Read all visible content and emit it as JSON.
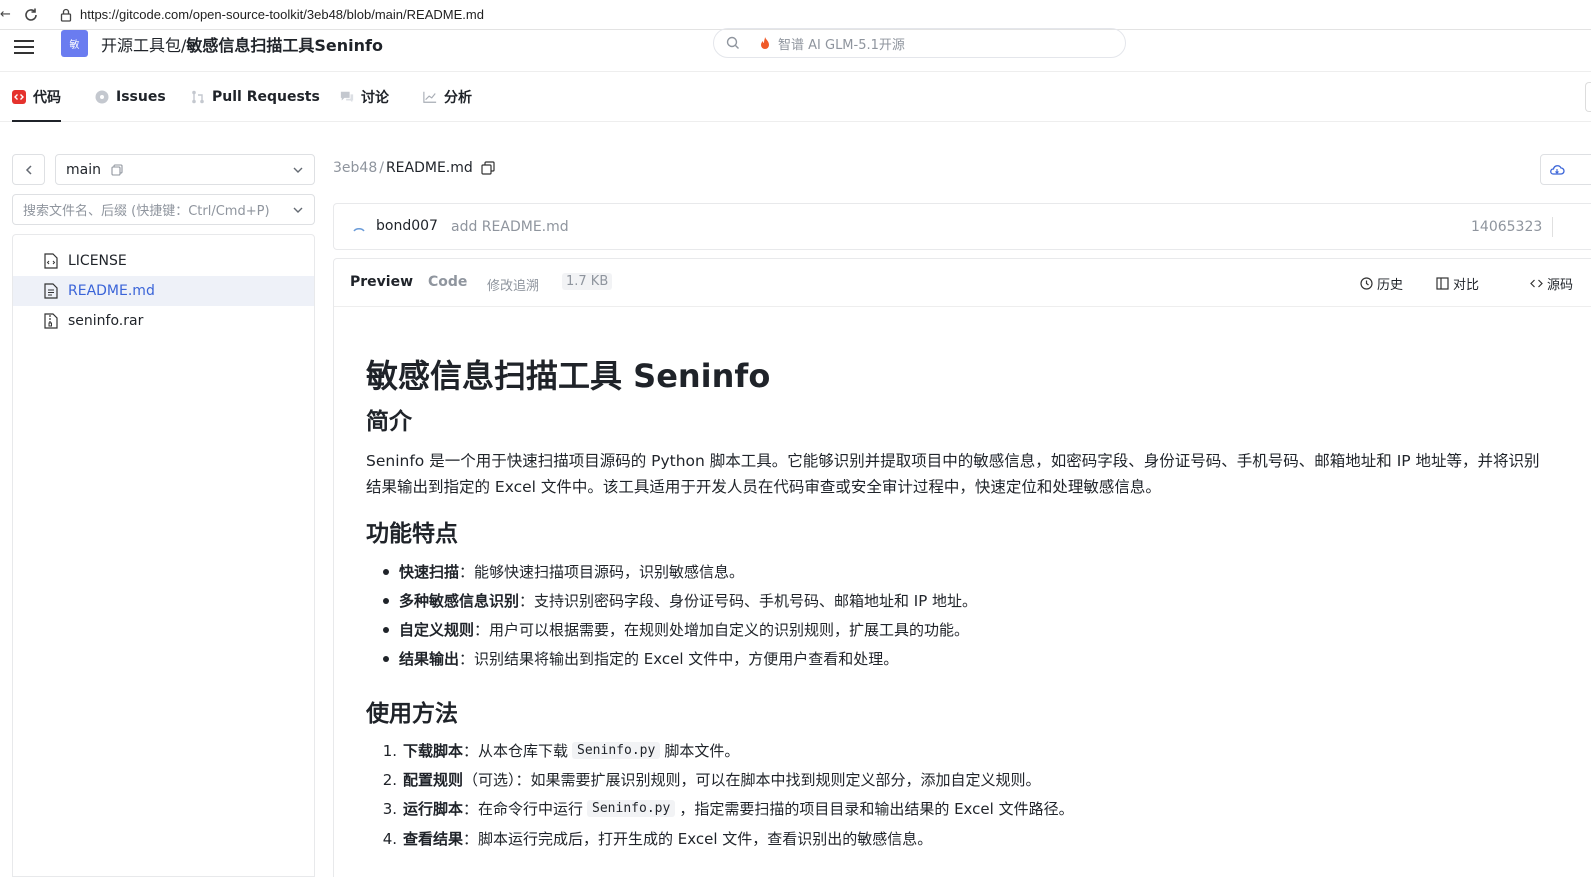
{
  "browser": {
    "back_glyph": "←",
    "url": "https://gitcode.com/open-source-toolkit/3eb48/blob/main/README.md"
  },
  "header": {
    "logo_text": "敏",
    "repo_owner": "开源工具包/",
    "repo_name": "敏感信息扫描工具Seninfo",
    "search_text": "智谱 AI GLM-5.1开源"
  },
  "tabs": [
    {
      "label": "代码",
      "icon": "code-icon"
    },
    {
      "label": "Issues",
      "icon": "issue-icon"
    },
    {
      "label": "Pull Requests",
      "icon": "pull-request-icon"
    },
    {
      "label": "讨论",
      "icon": "discussion-icon"
    },
    {
      "label": "分析",
      "icon": "chart-icon"
    }
  ],
  "sidebar": {
    "branch": "main",
    "search_placeholder": "搜索文件名、后缀 (快捷键：Ctrl/Cmd+P)",
    "files": [
      {
        "name": "LICENSE",
        "active": false
      },
      {
        "name": "README.md",
        "active": true
      },
      {
        "name": "seninfo.rar",
        "active": false
      }
    ]
  },
  "path": {
    "repo": "3eb48",
    "sep": "/",
    "file": "README.md"
  },
  "commit": {
    "author": "bond007",
    "message": "add README.md",
    "hash": "14065323"
  },
  "viewer": {
    "preview": "Preview",
    "code": "Code",
    "blame": "修改追溯",
    "size": "1.7 KB",
    "history": "历史",
    "compare": "对比",
    "source": "源码"
  },
  "readme": {
    "title": "敏感信息扫描工具 Seninfo",
    "intro_heading": "简介",
    "intro_line1": "Seninfo 是一个用于快速扫描项目源码的 Python 脚本工具。它能够识别并提取项目中的敏感信息，如密码字段、身份证号码、手机号码、邮箱地址和 IP 地址等，并将识别",
    "intro_line2": "结果输出到指定的 Excel 文件中。该工具适用于开发人员在代码审查或安全审计过程中，快速定位和处理敏感信息。",
    "features_heading": "功能特点",
    "features": [
      {
        "bold": "快速扫描",
        "text": "：能够快速扫描项目源码，识别敏感信息。"
      },
      {
        "bold": "多种敏感信息识别",
        "text": "：支持识别密码字段、身份证号码、手机号码、邮箱地址和 IP 地址。"
      },
      {
        "bold": "自定义规则",
        "text": "：用户可以根据需要，在规则处增加自定义的识别规则，扩展工具的功能。"
      },
      {
        "bold": "结果输出",
        "text": "：识别结果将输出到指定的 Excel 文件中，方便用户查看和处理。"
      }
    ],
    "usage_heading": "使用方法",
    "usage": [
      {
        "num": "1.",
        "bold": "下载脚本",
        "pre": "：从本仓库下载",
        "code": "Seninfo.py",
        "post": "脚本文件。"
      },
      {
        "num": "2.",
        "bold": "配置规则",
        "pre": "（可选）：如果需要扩展识别规则，可以在脚本中找到规则定义部分，添加自定义规则。",
        "code": "",
        "post": ""
      },
      {
        "num": "3.",
        "bold": "运行脚本",
        "pre": "：在命令行中运行",
        "code": "Seninfo.py",
        "post": "，指定需要扫描的项目目录和输出结果的 Excel 文件路径。"
      },
      {
        "num": "4.",
        "bold": "查看结果",
        "pre": "：脚本运行完成后，打开生成的 Excel 文件，查看识别出的敏感信息。",
        "code": "",
        "post": ""
      }
    ]
  }
}
